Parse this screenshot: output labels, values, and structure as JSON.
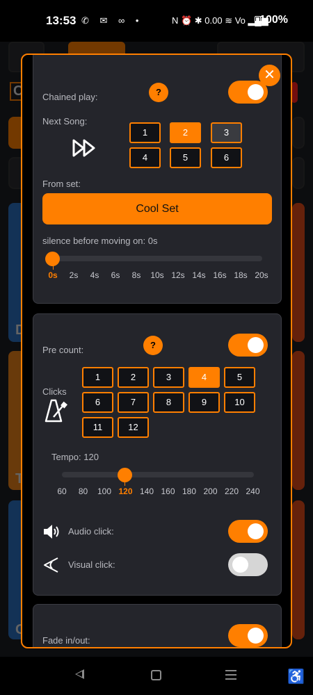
{
  "status_bar": {
    "time": "13:53",
    "left_icons": "✆ ✉ ∞ •",
    "right_icons": "N ⏰ ✱ 0.00 ≋ Vo ▂▄▆",
    "battery": "100%"
  },
  "background_app": {
    "letters": [
      "C",
      "D",
      "T",
      "G"
    ]
  },
  "modal": {
    "close_label": "✕",
    "chained": {
      "label": "Chained play:",
      "help": "?",
      "toggle_on": true,
      "next_song_label": "Next Song:",
      "next_song_options": [
        "1",
        "2",
        "3",
        "4",
        "5",
        "6"
      ],
      "next_song_selected": "2",
      "from_set_label": "From set:",
      "set_button": "Cool Set",
      "silence_label": "silence before moving on: 0s",
      "silence_ticks": [
        "0s",
        "2s",
        "4s",
        "6s",
        "8s",
        "10s",
        "12s",
        "14s",
        "16s",
        "18s",
        "20s"
      ],
      "silence_value": "0s"
    },
    "pre_count": {
      "label": "Pre count:",
      "help": "?",
      "toggle_on": true,
      "clicks_label": "Clicks",
      "click_options": [
        "1",
        "2",
        "3",
        "4",
        "5",
        "6",
        "7",
        "8",
        "9",
        "10",
        "11",
        "12"
      ],
      "click_selected": "4",
      "tempo_label": "Tempo: 120",
      "tempo_ticks": [
        "60",
        "80",
        "100",
        "120",
        "140",
        "160",
        "180",
        "200",
        "220",
        "240"
      ],
      "tempo_value": "120",
      "audio_click_label": "Audio click:",
      "audio_click_on": true,
      "visual_click_label": "Visual click:",
      "visual_click_on": false
    },
    "fade": {
      "label": "Fade in/out:",
      "toggle_on": true
    }
  },
  "colors": {
    "accent": "#ff7f00",
    "panel": "#24252b",
    "background": "#000000"
  }
}
